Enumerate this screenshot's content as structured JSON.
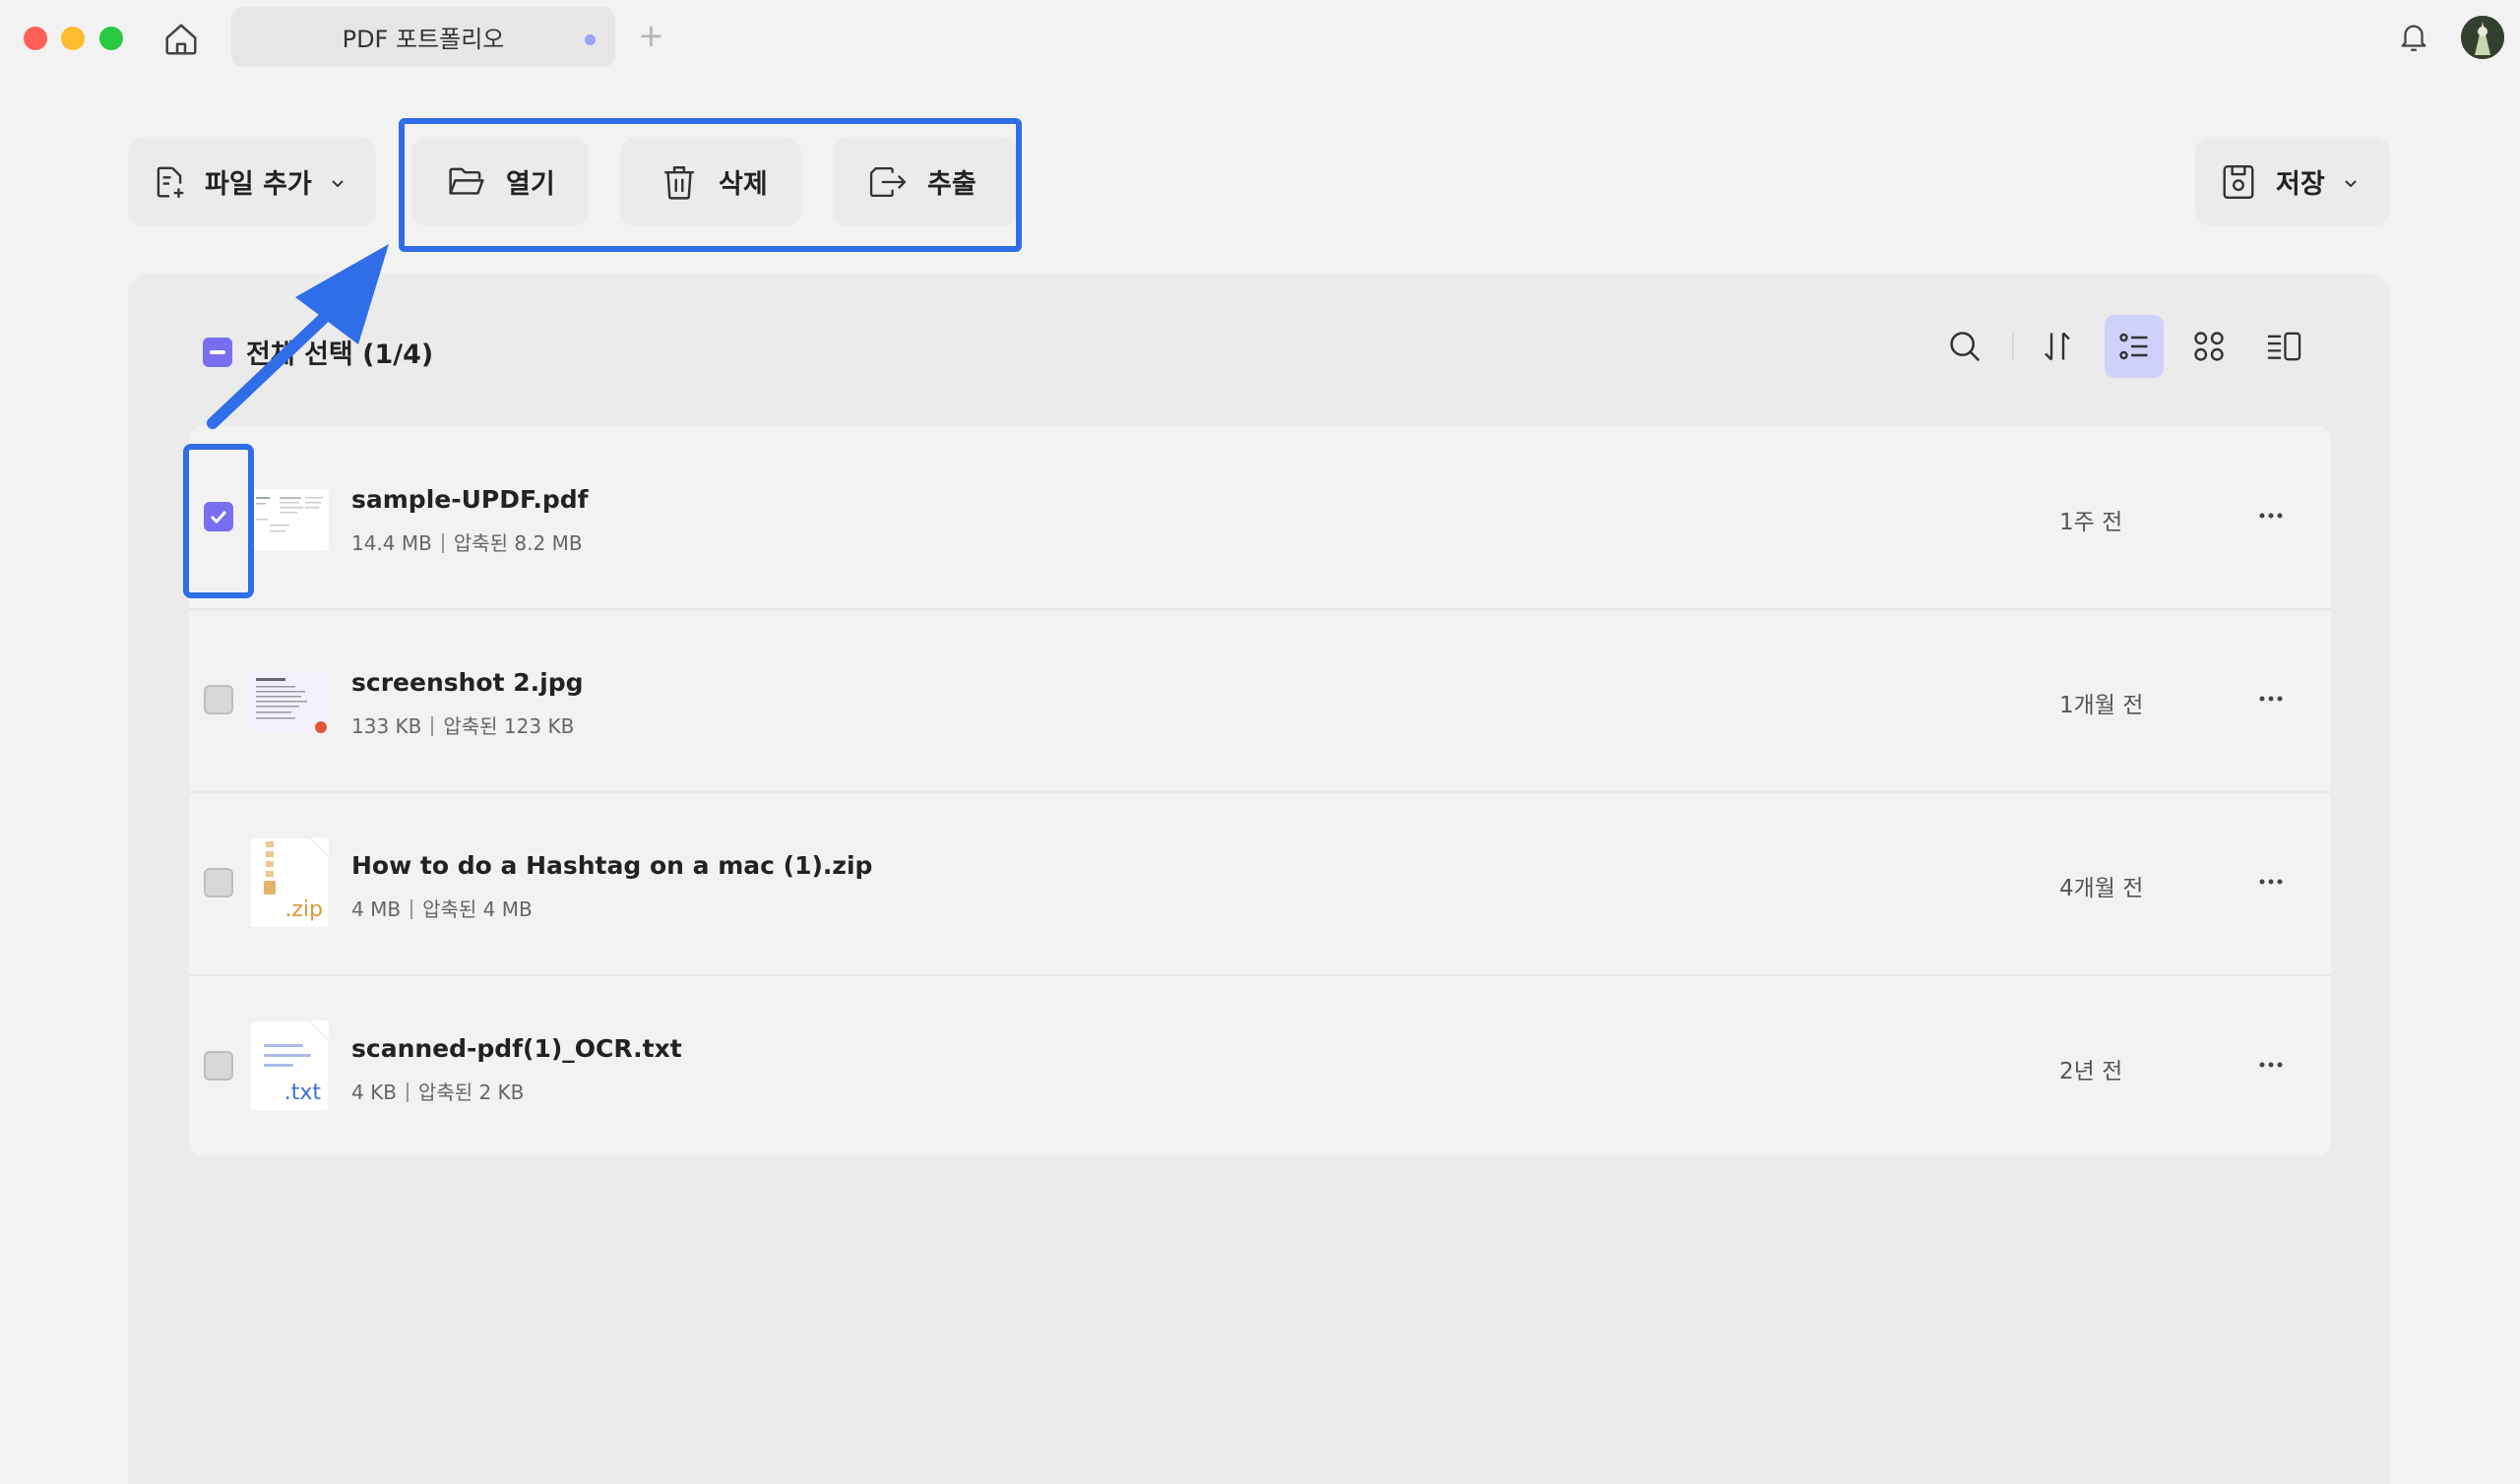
{
  "window": {
    "tab_title": "PDF 포트폴리오",
    "tab_add": "+"
  },
  "toolbar": {
    "add_file_label": "파일 추가",
    "open_label": "열기",
    "delete_label": "삭제",
    "extract_label": "추출",
    "save_label": "저장"
  },
  "list_header": {
    "select_all_label": "전체 선택 (1/4)"
  },
  "files": [
    {
      "name": "sample-UPDF.pdf",
      "size": "14.4 MB",
      "compressed": "압축된 8.2 MB",
      "date": "1주 전",
      "checked": true
    },
    {
      "name": "screenshot 2.jpg",
      "size": "133 KB",
      "compressed": "압축된 123 KB",
      "date": "1개월 전",
      "checked": false
    },
    {
      "name": "How to do a Hashtag on a mac (1).zip",
      "size": "4 MB",
      "compressed": "압축된 4 MB",
      "date": "4개월 전",
      "checked": false,
      "ext": ".zip"
    },
    {
      "name": "scanned-pdf(1)_OCR.txt",
      "size": "4 KB",
      "compressed": "압축된 2 KB",
      "date": "2년 전",
      "checked": false,
      "ext": ".txt"
    }
  ],
  "colors": {
    "accent": "#7a6ef0",
    "highlight": "#2f6ee8",
    "view_active": "#cfd0fb"
  }
}
